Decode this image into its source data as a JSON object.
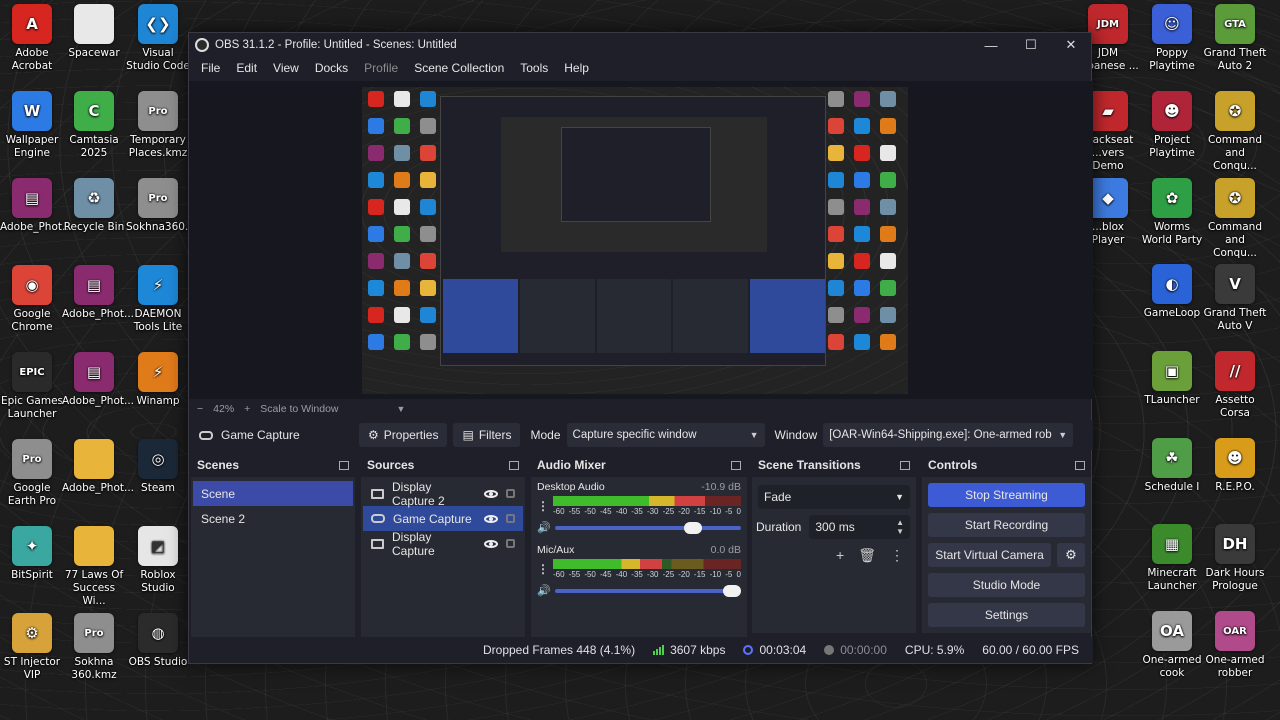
{
  "desktop": {
    "left_icons": [
      {
        "label": "Adobe Acrobat",
        "icon": "acrobat-icon",
        "color": "#d7261f",
        "glyph": "A"
      },
      {
        "label": "Spacewar",
        "icon": "file-icon",
        "color": "#e8e8e8",
        "glyph": ""
      },
      {
        "label": "Visual Studio Code",
        "icon": "vscode-icon",
        "color": "#1f86d6",
        "glyph": "❮❯"
      },
      {
        "label": "Wallpaper Engine",
        "icon": "wallpaper-engine-icon",
        "color": "#2c7be5",
        "glyph": "W"
      },
      {
        "label": "Camtasia 2025",
        "icon": "camtasia-icon",
        "color": "#3fae49",
        "glyph": "C"
      },
      {
        "label": "Temporary Places.kmz",
        "icon": "kmz-icon",
        "color": "#8e8e8e",
        "glyph": "Pro"
      },
      {
        "label": "Adobe_Phot...",
        "icon": "winrar-icon",
        "color": "#8a2a6f",
        "glyph": "▤"
      },
      {
        "label": "Recycle Bin",
        "icon": "recycle-bin-icon",
        "color": "#6f8fa6",
        "glyph": "♻"
      },
      {
        "label": "Sokhna360...",
        "icon": "kmz-icon",
        "color": "#8e8e8e",
        "glyph": "Pro"
      },
      {
        "label": "Google Chrome",
        "icon": "chrome-icon",
        "color": "#db4437",
        "glyph": "◉"
      },
      {
        "label": "Adobe_Phot...",
        "icon": "winrar-icon",
        "color": "#8a2a6f",
        "glyph": "▤"
      },
      {
        "label": "DAEMON Tools Lite",
        "icon": "daemon-tools-icon",
        "color": "#1e88d8",
        "glyph": "⚡"
      },
      {
        "label": "Epic Games Launcher",
        "icon": "epic-games-icon",
        "color": "#2a2a2a",
        "glyph": "EPIC"
      },
      {
        "label": "Adobe_Phot...",
        "icon": "winrar-icon",
        "color": "#8a2a6f",
        "glyph": "▤"
      },
      {
        "label": "Winamp",
        "icon": "winamp-icon",
        "color": "#e07b1a",
        "glyph": "⚡"
      },
      {
        "label": "Google Earth Pro",
        "icon": "google-earth-icon",
        "color": "#8e8e8e",
        "glyph": "Pro"
      },
      {
        "label": "Adobe_Phot...",
        "icon": "folder-icon",
        "color": "#e8b43a",
        "glyph": ""
      },
      {
        "label": "Steam",
        "icon": "steam-icon",
        "color": "#1b2838",
        "glyph": "◎"
      },
      {
        "label": "BitSpirit",
        "icon": "bitspirit-icon",
        "color": "#3aa7a0",
        "glyph": "✦"
      },
      {
        "label": "77 Laws Of Success Wi...",
        "icon": "folder-icon",
        "color": "#e8b43a",
        "glyph": ""
      },
      {
        "label": "Roblox Studio",
        "icon": "roblox-studio-icon",
        "color": "#e6e6e6",
        "glyph": "◩"
      },
      {
        "label": "ST Injector VIP",
        "icon": "st-injector-icon",
        "color": "#d8a23a",
        "glyph": "⚙"
      },
      {
        "label": "Sokhna 360.kmz",
        "icon": "kmz-icon",
        "color": "#8e8e8e",
        "glyph": "Pro"
      },
      {
        "label": "OBS Studio",
        "icon": "obs-icon",
        "color": "#2b2b2b",
        "glyph": "◍"
      }
    ],
    "right_icons": [
      {
        "label": "JDM ...panese ...",
        "icon": "jdm-icon",
        "color": "#c0282d",
        "glyph": "JDM"
      },
      {
        "label": "Poppy Playtime",
        "icon": "poppy-playtime-icon",
        "color": "#3b5fd6",
        "glyph": "☺"
      },
      {
        "label": "Grand Theft Auto 2",
        "icon": "gta2-icon",
        "color": "#5b9b3a",
        "glyph": "GTA"
      },
      {
        "label": "...ackseat ...vers Demo",
        "icon": "car-icon",
        "color": "#c0282d",
        "glyph": "▰"
      },
      {
        "label": "Project Playtime",
        "icon": "project-playtime-icon",
        "color": "#b0243a",
        "glyph": "☻"
      },
      {
        "label": "Command and Conqu...",
        "icon": "cnc-icon",
        "color": "#c7a12a",
        "glyph": "✪"
      },
      {
        "label": "...blox Player",
        "icon": "roblox-icon",
        "color": "#3e7be0",
        "glyph": "◆"
      },
      {
        "label": "Worms World Party",
        "icon": "worms-icon",
        "color": "#2f9f46",
        "glyph": "✿"
      },
      {
        "label": "Command and Conqu...",
        "icon": "cnc-icon",
        "color": "#c7a12a",
        "glyph": "✪"
      },
      {
        "label": "GameLoop",
        "icon": "gameloop-icon",
        "color": "#2a62d8",
        "glyph": "◐"
      },
      {
        "label": "Grand Theft Auto V",
        "icon": "gtav-icon",
        "color": "#3a3a3a",
        "glyph": "V"
      },
      {
        "label": "TLauncher",
        "icon": "tlauncher-icon",
        "color": "#6a9f3a",
        "glyph": "▣"
      },
      {
        "label": "Assetto Corsa",
        "icon": "assetto-corsa-icon",
        "color": "#c0282d",
        "glyph": "//"
      },
      {
        "label": "Schedule I",
        "icon": "schedule-icon",
        "color": "#4f9d47",
        "glyph": "☘"
      },
      {
        "label": "R.E.P.O.",
        "icon": "repo-icon",
        "color": "#d89b1a",
        "glyph": "☻"
      },
      {
        "label": "Minecraft Launcher",
        "icon": "minecraft-icon",
        "color": "#3b8a2c",
        "glyph": "▦"
      },
      {
        "label": "Dark Hours Prologue",
        "icon": "dark-hours-icon",
        "color": "#3a3a3a",
        "glyph": "DH"
      },
      {
        "label": "One-armed cook",
        "icon": "one-armed-cook-icon",
        "color": "#9a9a9a",
        "glyph": "OA"
      },
      {
        "label": "One-armed robber",
        "icon": "one-armed-robber-icon",
        "color": "#b04a8a",
        "glyph": "OAR"
      }
    ]
  },
  "window": {
    "title": "OBS 31.1.2 - Profile: Untitled - Scenes: Untitled",
    "min": "—",
    "max": "☐",
    "close": "✕"
  },
  "menu": [
    "File",
    "Edit",
    "View",
    "Docks",
    "Profile",
    "Scene Collection",
    "Tools",
    "Help"
  ],
  "zoom": {
    "minus": "−",
    "value": "42%",
    "plus": "+",
    "fit": "Scale to Window",
    "caret": "▼"
  },
  "source_toolbar": {
    "source_name": "Game Capture",
    "properties": "Properties",
    "filters": "Filters",
    "mode_label": "Mode",
    "mode_value": "Capture specific window",
    "window_label": "Window",
    "window_value": "[OAR-Win64-Shipping.exe]: One-armed robb"
  },
  "scenes": {
    "title": "Scenes",
    "items": [
      "Scene",
      "Scene 2"
    ],
    "selected": 0
  },
  "sources": {
    "title": "Sources",
    "items": [
      {
        "name": "Display Capture 2",
        "icon": "monitor-icon"
      },
      {
        "name": "Game Capture",
        "icon": "gamepad-icon"
      },
      {
        "name": "Display Capture",
        "icon": "monitor-icon"
      }
    ],
    "selected": 1
  },
  "mixer": {
    "title": "Audio Mixer",
    "channels": [
      {
        "name": "Desktop Audio",
        "db": "-10.9 dB",
        "level": 0.81,
        "volume": 0.79
      },
      {
        "name": "Mic/Aux",
        "db": "0.0 dB",
        "level": 0.58,
        "volume": 1.0
      }
    ],
    "ticks": [
      "-60",
      "-55",
      "-50",
      "-45",
      "-40",
      "-35",
      "-30",
      "-25",
      "-20",
      "-15",
      "-10",
      "-5",
      "0"
    ]
  },
  "transitions": {
    "title": "Scene Transitions",
    "value": "Fade",
    "duration_label": "Duration",
    "duration_value": "300 ms"
  },
  "controls": {
    "title": "Controls",
    "stop_streaming": "Stop Streaming",
    "start_recording": "Start Recording",
    "start_virtual_camera": "Start Virtual Camera",
    "studio_mode": "Studio Mode",
    "settings": "Settings"
  },
  "status": {
    "dropped_frames": "Dropped Frames 448 (4.1%)",
    "bitrate": "3607 kbps",
    "stream_time": "00:03:04",
    "rec_time": "00:00:00",
    "cpu": "CPU: 5.9%",
    "fps": "60.00 / 60.00 FPS"
  },
  "colors": {
    "accent": "#3c5bd4",
    "selection": "#2f4a9a",
    "meter_green": "#3fbb2c",
    "meter_yellow": "#d4b72a",
    "meter_red": "#d14141"
  }
}
